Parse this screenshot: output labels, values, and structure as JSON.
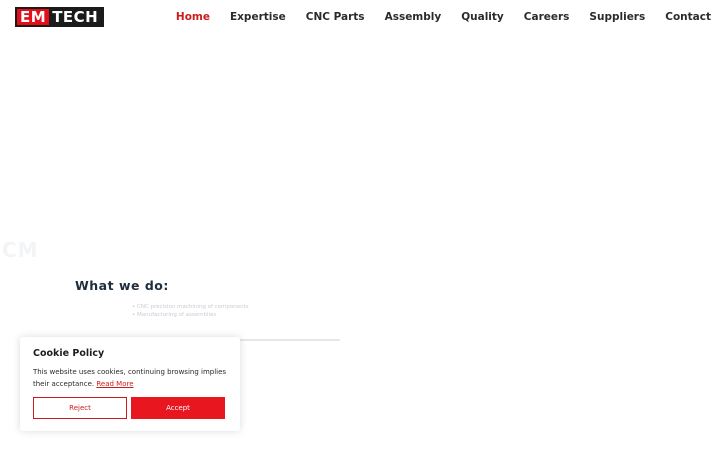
{
  "brand": {
    "logo_left": "EM",
    "logo_right": "TECH"
  },
  "nav": {
    "items": [
      {
        "label": "Home",
        "active": true
      },
      {
        "label": "Expertise"
      },
      {
        "label": "CNC Parts"
      },
      {
        "label": "Assembly"
      },
      {
        "label": "Quality"
      },
      {
        "label": "Careers"
      },
      {
        "label": "Suppliers"
      },
      {
        "label": "Contact"
      }
    ]
  },
  "hero": {
    "ghost_label": "CM"
  },
  "section": {
    "title": "What we do:",
    "items": [
      "CNC precision machining of components",
      "Manufacturing of assemblies"
    ]
  },
  "cookie": {
    "title": "Cookie Policy",
    "text": "This website uses cookies, continuing browsing implies their acceptance.",
    "link": "Read More",
    "reject_label": "Reject",
    "accept_label": "Accept"
  },
  "colors": {
    "accent": "#cc1d1d",
    "button_primary": "#e8161f",
    "logo_dark": "#1b1b1b"
  }
}
